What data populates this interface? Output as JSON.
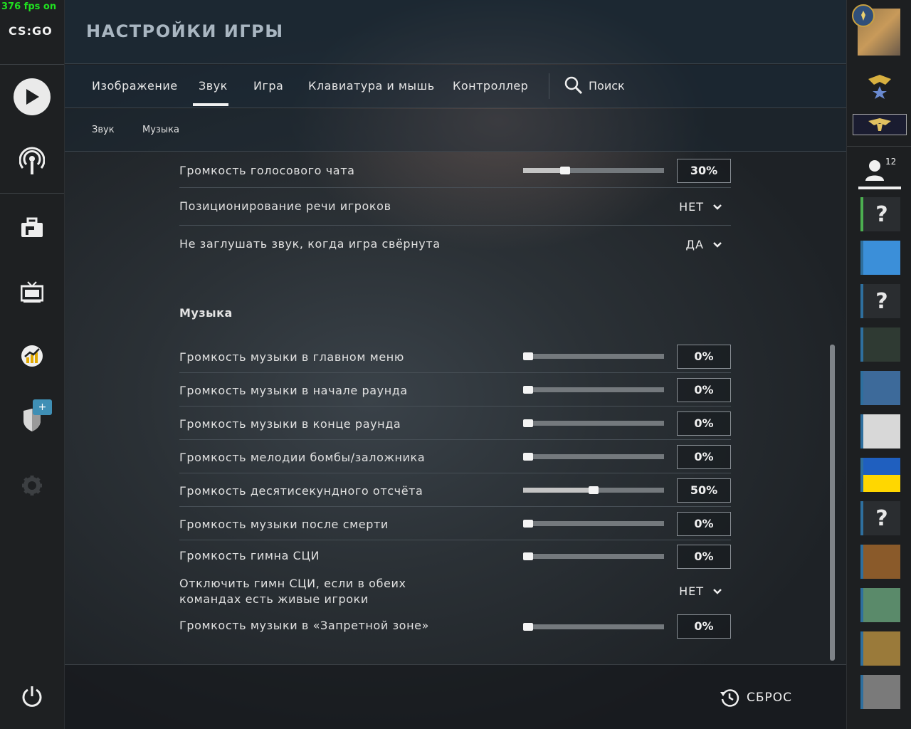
{
  "overlay": {
    "fps": "376 fps on"
  },
  "logo": "CS:GO",
  "header": {
    "title": "НАСТРОЙКИ ИГРЫ"
  },
  "tabs": [
    {
      "label": "Изображение"
    },
    {
      "label": "Звук",
      "active": true
    },
    {
      "label": "Игра"
    },
    {
      "label": "Клавиатура и мышь"
    },
    {
      "label": "Контроллер"
    }
  ],
  "search": {
    "label": "Поиск"
  },
  "subtabs": [
    {
      "label": "Звук"
    },
    {
      "label": "Музыка"
    }
  ],
  "settings": {
    "voice_chat_volume": {
      "label": "Громкость голосового чата",
      "value": "30%",
      "level": 0.3
    },
    "player_voice_positioning": {
      "label": "Позиционирование речи игроков",
      "value": "НЕТ"
    },
    "no_mute_when_minimized": {
      "label": "Не заглушать звук, когда игра свёрнута",
      "value": "ДА"
    }
  },
  "music": {
    "title": "Музыка",
    "rows": [
      {
        "label": "Громкость музыки в главном меню",
        "value": "0%",
        "level": 0
      },
      {
        "label": "Громкость музыки в начале раунда",
        "value": "0%",
        "level": 0
      },
      {
        "label": "Громкость музыки в конце раунда",
        "value": "0%",
        "level": 0
      },
      {
        "label": "Громкость мелодии бомбы/заложника",
        "value": "0%",
        "level": 0
      },
      {
        "label": "Громкость десятисекундного отсчёта",
        "value": "50%",
        "level": 0.5
      },
      {
        "label": "Громкость музыки после смерти",
        "value": "0%",
        "level": 0
      },
      {
        "label": "Громкость гимна СЦИ",
        "value": "0%",
        "level": 0
      }
    ],
    "disable_mvp": {
      "label_line1": "Отключить гимн СЦИ, если в обеих",
      "label_line2": "командах есть живые игроки",
      "value": "НЕТ"
    },
    "danger_zone": {
      "label": "Громкость музыки в «Запретной зоне»",
      "value": "0%",
      "level": 0
    }
  },
  "footer": {
    "reset_label": "СБРОС"
  },
  "friends": {
    "count": "12",
    "list": [
      {
        "icon": "unknown-avatar",
        "text": "?",
        "status_color": "#4caf50",
        "bg": "#2a2d30"
      },
      {
        "icon": "mascot-avatar",
        "text": "",
        "status_color": "#2e6f9e",
        "bg": "#3b8fd9"
      },
      {
        "icon": "unknown-avatar",
        "text": "?",
        "status_color": "#2e6f9e",
        "bg": "#2a2d30"
      },
      {
        "icon": "hooded-figure-avatar",
        "text": "",
        "status_color": "#2e6f9e",
        "bg": "#2f3a33"
      },
      {
        "icon": "cat-astronaut-avatar",
        "text": "",
        "status_color": "#2e6f9e",
        "bg": "#3d6a9a"
      },
      {
        "icon": "bear-avatar",
        "text": "",
        "status_color": "#2e6f9e",
        "bg": "#d8d8d8"
      },
      {
        "icon": "flag-avatar",
        "text": "",
        "status_color": "#2e6f9e",
        "bg": "#1f5fbf"
      },
      {
        "icon": "unknown-avatar",
        "text": "?",
        "status_color": "#2e6f9e",
        "bg": "#2a2d30"
      },
      {
        "icon": "sunset-avatar",
        "text": "",
        "status_color": "#2e6f9e",
        "bg": "#8a5a2a"
      },
      {
        "icon": "anime-avatar",
        "text": "",
        "status_color": "#2e6f9e",
        "bg": "#5a8a6a"
      },
      {
        "icon": "bird-avatar",
        "text": "",
        "status_color": "#2e6f9e",
        "bg": "#9a7a3a"
      },
      {
        "icon": "street-avatar",
        "text": "",
        "status_color": "#2e6f9e",
        "bg": "#7a7a7a"
      }
    ]
  }
}
